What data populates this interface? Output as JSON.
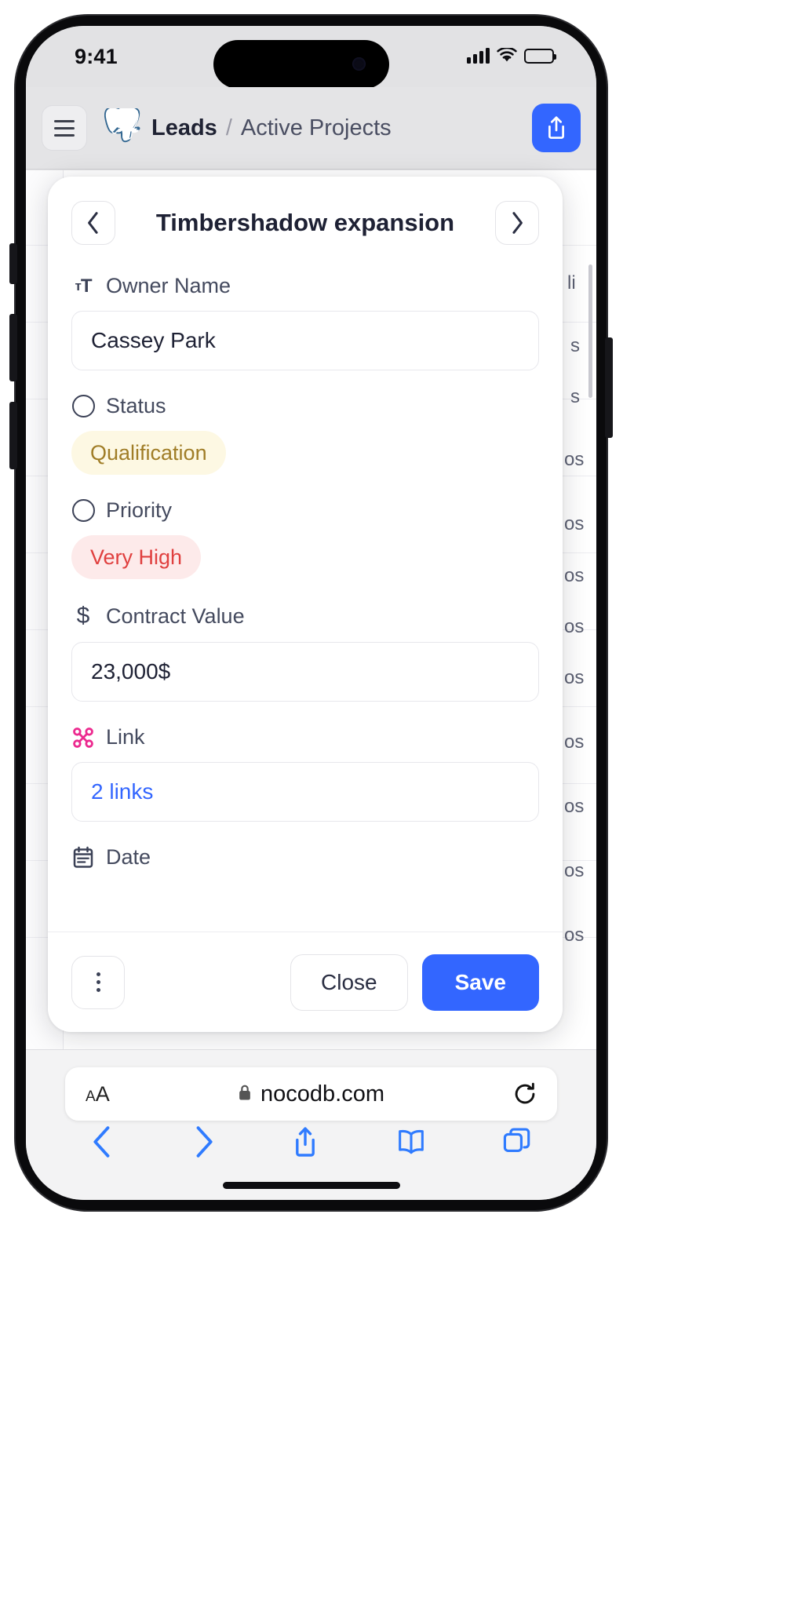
{
  "status_bar": {
    "time": "9:41",
    "signal_icon": "cellular-signal-icon",
    "wifi_icon": "wifi-icon",
    "battery_icon": "battery-full-icon"
  },
  "app_header": {
    "menu_icon": "hamburger-menu-icon",
    "db_logo_icon": "postgresql-elephant-icon",
    "breadcrumb": {
      "base": "Leads",
      "separator": "/",
      "current": "Active Projects"
    },
    "share_icon": "share-upload-icon"
  },
  "grid_background": {
    "fragments": [
      "li",
      "s",
      "s",
      "os",
      "os",
      "os",
      "os",
      "os",
      "os",
      "os",
      "os"
    ]
  },
  "record": {
    "prev_icon": "chevron-left-icon",
    "next_icon": "chevron-right-icon",
    "title": "Timbershadow expansion",
    "fields": [
      {
        "name": "owner-name",
        "icon": "single-line-text-icon",
        "label": "Owner Name",
        "type": "text",
        "value": "Cassey Park"
      },
      {
        "name": "status",
        "icon": "single-select-icon",
        "label": "Status",
        "type": "badge",
        "value": "Qualification",
        "bg_color": "#fdf8e3",
        "text_color": "#a07d27"
      },
      {
        "name": "priority",
        "icon": "single-select-icon",
        "label": "Priority",
        "type": "badge",
        "value": "Very High",
        "bg_color": "#fdeaea",
        "text_color": "#e0403f"
      },
      {
        "name": "contract-value",
        "icon": "currency-dollar-icon",
        "label": "Contract Value",
        "type": "text",
        "value": "23,000$"
      },
      {
        "name": "link",
        "icon": "link-records-icon",
        "label": "Link",
        "type": "link",
        "value": "2 links",
        "link_color": "#3366ff"
      },
      {
        "name": "date",
        "icon": "calendar-icon",
        "label": "Date",
        "type": "date",
        "value": ""
      }
    ],
    "footer": {
      "more_icon": "more-vertical-icon",
      "close_label": "Close",
      "save_label": "Save",
      "save_color": "#3366ff"
    }
  },
  "safari": {
    "text_size_label": "AA",
    "lock_icon": "lock-icon",
    "url": "nocodb.com",
    "reload_icon": "reload-icon",
    "nav": [
      {
        "name": "back",
        "icon": "chevron-left-icon"
      },
      {
        "name": "forward",
        "icon": "chevron-right-icon"
      },
      {
        "name": "share",
        "icon": "share-upload-icon"
      },
      {
        "name": "bookmarks",
        "icon": "book-icon"
      },
      {
        "name": "tabs",
        "icon": "tabs-copy-icon"
      }
    ]
  }
}
